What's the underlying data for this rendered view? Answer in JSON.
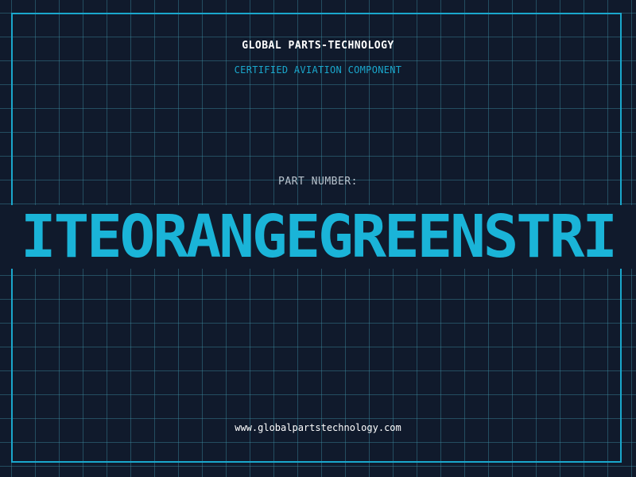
{
  "header": {
    "company": "GLOBAL PARTS-TECHNOLOGY",
    "subtitle": "CERTIFIED AVIATION COMPONENT"
  },
  "part": {
    "label": "PART NUMBER:",
    "number": "ITEORANGEGREENSTRI"
  },
  "footer": {
    "url": "www.globalpartstechnology.com"
  },
  "colors": {
    "background": "#101a2c",
    "accent": "#1aa7cc",
    "part_number": "#1ab4d8",
    "grid": "#3c8ca0"
  }
}
